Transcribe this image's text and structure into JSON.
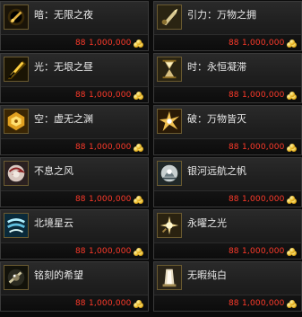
{
  "items": [
    {
      "name": "暗：无限之夜",
      "level": "88",
      "price": "1,000,000",
      "icon": "dark-orb-icon",
      "tone": "#3a2a0a"
    },
    {
      "name": "引力：万物之拥",
      "level": "88",
      "price": "1,000,000",
      "icon": "gravity-arrow-icon",
      "tone": "#5a4a20"
    },
    {
      "name": "光：无垠之昼",
      "level": "88",
      "price": "1,000,000",
      "icon": "light-slash-icon",
      "tone": "#4a3a08"
    },
    {
      "name": "时：永恒凝滞",
      "level": "88",
      "price": "1,000,000",
      "icon": "time-hourglass-icon",
      "tone": "#5a4a20"
    },
    {
      "name": "空：虚无之渊",
      "level": "88",
      "price": "1,000,000",
      "icon": "void-hex-icon",
      "tone": "#6a4a08"
    },
    {
      "name": "破：万物皆灭",
      "level": "88",
      "price": "1,000,000",
      "icon": "break-burst-icon",
      "tone": "#6a4a18"
    },
    {
      "name": "不息之风",
      "level": "88",
      "price": "1,000,000",
      "icon": "wind-swirl-icon",
      "tone": "#3a2a2a"
    },
    {
      "name": "银河远航之帆",
      "level": "88",
      "price": "1,000,000",
      "icon": "galaxy-sail-icon",
      "tone": "#2a3a3a"
    },
    {
      "name": "北境星云",
      "level": "88",
      "price": "1,000,000",
      "icon": "nebula-gust-icon",
      "tone": "#1a3a4a"
    },
    {
      "name": "永曜之光",
      "level": "88",
      "price": "1,000,000",
      "icon": "radiant-sun-icon",
      "tone": "#5a4a18"
    },
    {
      "name": "铭刻的希望",
      "level": "88",
      "price": "1,000,000",
      "icon": "hope-stone-icon",
      "tone": "#2a2a1a"
    },
    {
      "name": "无暇纯白",
      "level": "88",
      "price": "1,000,000",
      "icon": "white-crest-icon",
      "tone": "#5a4a28"
    }
  ]
}
